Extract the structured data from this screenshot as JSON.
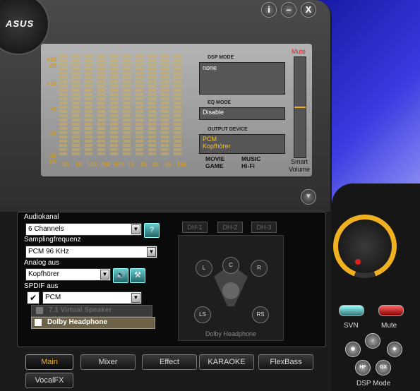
{
  "window": {
    "logo": "ASUS",
    "info": "i",
    "minimize": "–",
    "close": "X"
  },
  "eq": {
    "db_labels": [
      "+20 dB",
      "+10",
      "+0",
      "-10",
      "-20 dB"
    ],
    "bands": [
      "30",
      "60",
      "120",
      "250",
      "500",
      "1k",
      "2k",
      "4k",
      "8k",
      "16k"
    ]
  },
  "dsp_mode": {
    "label": "DSP MODE",
    "value": "none"
  },
  "eq_mode": {
    "label": "EQ MODE",
    "value": "Disable"
  },
  "output_device": {
    "label": "OUTPUT DEVICE",
    "line1": "PCM",
    "line2": "Kopfhörer"
  },
  "modes": [
    "MOVIE",
    "MUSIC",
    "GAME",
    "Hi-Fi"
  ],
  "volume": {
    "mute_label": "Mute",
    "smart_label": "Smart Volume"
  },
  "controls": {
    "audiokanal_label": "Audiokanal",
    "audiokanal_value": "6 Channels",
    "help": "?",
    "sampling_label": "Samplingfrequenz",
    "sampling_value": "PCM 96 KHz",
    "analog_label": "Analog aus",
    "analog_value": "Kopfhörer",
    "spdif_label": "SPDIF aus",
    "spdif_value": "PCM",
    "virtual_speaker": "7.1 Virtual Speaker",
    "dolby_headphone": "Dolby Headphone"
  },
  "dh": {
    "buttons": [
      "DH-1",
      "DH-2",
      "DH-3"
    ],
    "caption": "Dolby Headphone",
    "speakers": {
      "l": "L",
      "c": "C",
      "r": "R",
      "ls": "LS",
      "rs": "RS"
    }
  },
  "tabs": [
    "Main",
    "Mixer",
    "Effect",
    "KARAOKE",
    "FlexBass",
    "VocalFX"
  ],
  "right": {
    "svn": "SVN",
    "mute": "Mute",
    "dsp_mode": "DSP Mode",
    "hf": "HF",
    "gx": "GX"
  },
  "colors": {
    "accent": "#f0b020",
    "mute": "#e02020",
    "svn": "#5cc"
  }
}
